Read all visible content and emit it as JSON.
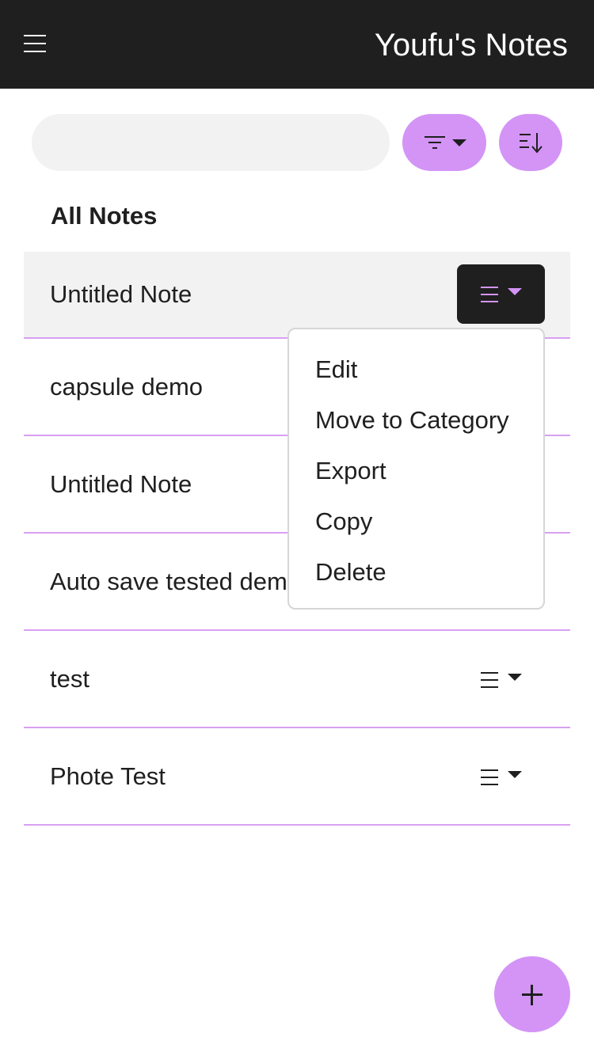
{
  "header": {
    "title": "Youfu's Notes",
    "menu_icon": "hamburger-menu-icon",
    "background": "#1f1f1f"
  },
  "toolbar": {
    "search_value": "",
    "search_placeholder": "",
    "filter_icon": "filter-icon",
    "sort_icon": "sort-descending-icon",
    "accent": "#d394f6"
  },
  "section": {
    "title": "All Notes"
  },
  "notes": [
    {
      "title": "Untitled Note",
      "active": true
    },
    {
      "title": "capsule demo",
      "active": false
    },
    {
      "title": "Untitled Note",
      "active": false
    },
    {
      "title": "Auto save tested dem",
      "active": false
    },
    {
      "title": "test",
      "active": false
    },
    {
      "title": "Phote Test",
      "active": false
    }
  ],
  "note_menu": {
    "icon": "list-icon",
    "items": [
      "Edit",
      "Move to Category",
      "Export",
      "Copy",
      "Delete"
    ]
  },
  "fab": {
    "icon": "plus-icon"
  },
  "colors": {
    "accent": "#d394f6",
    "divider": "#d8a0f2",
    "active_row": "#f2f2f2"
  }
}
